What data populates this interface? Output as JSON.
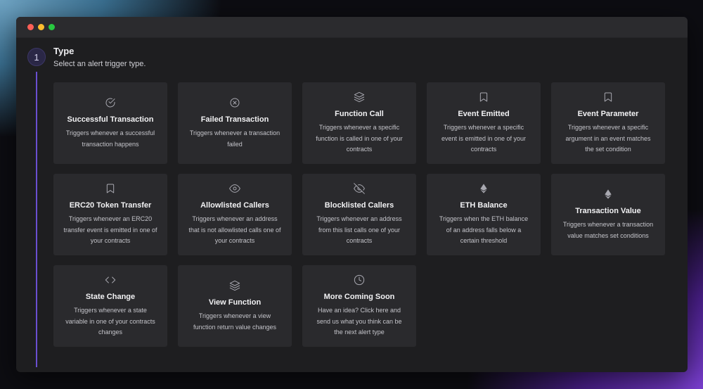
{
  "window": {
    "controls": [
      "close",
      "minimize",
      "maximize"
    ]
  },
  "step": {
    "number": "1",
    "title": "Type",
    "subtitle": "Select an alert trigger type."
  },
  "triggers": [
    {
      "icon": "check-circle-icon",
      "name": "Successful Transaction",
      "description": "Triggers whenever a successful transaction happens"
    },
    {
      "icon": "x-circle-icon",
      "name": "Failed Transaction",
      "description": "Triggers whenever a transaction failed"
    },
    {
      "icon": "layers-icon",
      "name": "Function Call",
      "description": "Triggers whenever a specific function is called in one of your contracts"
    },
    {
      "icon": "bookmark-icon",
      "name": "Event Emitted",
      "description": "Triggers whenever a specific event is emitted in one of your contracts"
    },
    {
      "icon": "bookmark-icon",
      "name": "Event Parameter",
      "description": "Triggers whenever a specific argument in an event matches the set condition"
    },
    {
      "icon": "bookmark-icon",
      "name": "ERC20 Token Transfer",
      "description": "Triggers whenever an ERC20 transfer event is emitted in one of your contracts"
    },
    {
      "icon": "eye-icon",
      "name": "Allowlisted Callers",
      "description": "Triggers whenever an address that is not allowlisted calls one of your contracts"
    },
    {
      "icon": "eye-off-icon",
      "name": "Blocklisted Callers",
      "description": "Triggers whenever an address from this list calls one of your contracts"
    },
    {
      "icon": "ethereum-icon",
      "name": "ETH Balance",
      "description": "Triggers when the ETH balance of an address falls below a certain threshold"
    },
    {
      "icon": "ethereum-icon",
      "name": "Transaction Value",
      "description": "Triggers whenever a transaction value matches set conditions"
    },
    {
      "icon": "code-icon",
      "name": "State Change",
      "description": "Triggers whenever a state variable in one of your contracts changes"
    },
    {
      "icon": "layers-icon",
      "name": "View Function",
      "description": "Triggers whenever a view function return value changes"
    },
    {
      "icon": "clock-icon",
      "name": "More Coming Soon",
      "description": "Have an idea? Click here and send us what you think can be the next alert type"
    }
  ]
}
